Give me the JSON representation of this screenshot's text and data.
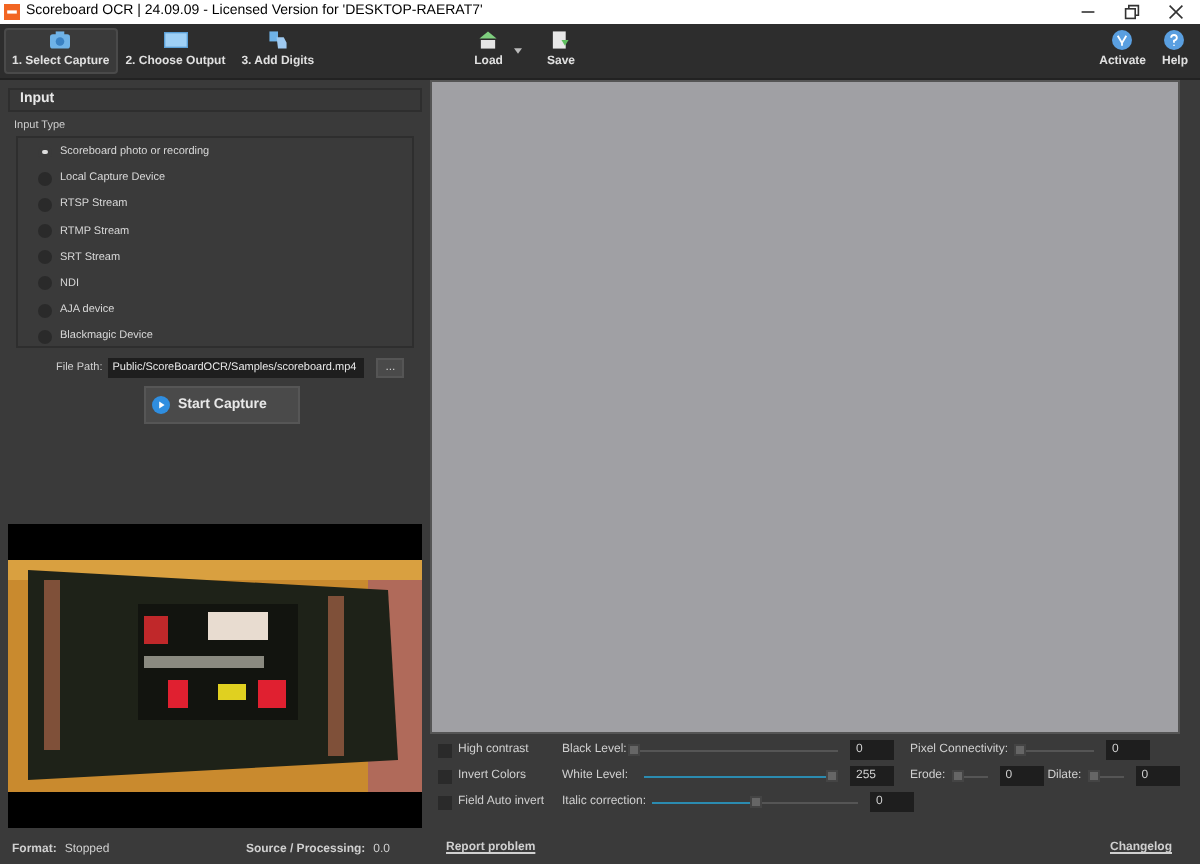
{
  "window": {
    "title": "Scoreboard OCR | 24.09.09 - Licensed Version for 'DESKTOP-RAERAT7'"
  },
  "toolbar": {
    "steps": [
      {
        "label": "1. Select Capture",
        "selected": true,
        "kind": "camera"
      },
      {
        "label": "2. Choose Output",
        "selected": false,
        "kind": "screen"
      },
      {
        "label": "3. Add Digits",
        "selected": false,
        "kind": "hand"
      }
    ],
    "actions": [
      {
        "label": "Load",
        "kind": "load"
      },
      {
        "label": "Save",
        "kind": "save"
      }
    ],
    "right": [
      {
        "label": "Activate",
        "kind": "activate"
      },
      {
        "label": "Help",
        "kind": "help"
      }
    ]
  },
  "input": {
    "header": "Input",
    "type_label": "Input Type",
    "options": [
      {
        "label": "Scoreboard photo or recording",
        "selected": true
      },
      {
        "label": "Local Capture Device",
        "selected": false
      },
      {
        "label": "RTSP Stream",
        "selected": false
      },
      {
        "label": "RTMP Stream",
        "selected": false
      },
      {
        "label": "SRT Stream",
        "selected": false
      },
      {
        "label": "NDI",
        "selected": false
      },
      {
        "label": "AJA device",
        "selected": false
      },
      {
        "label": "Blackmagic Device",
        "selected": false
      }
    ],
    "file_path_label": "File Path:",
    "file_path": "Public/ScoreBoardOCR/Samples/scoreboard.mp4",
    "browse": "...",
    "start": "Start Capture"
  },
  "status": {
    "format_label": "Format:",
    "format": "Stopped",
    "source_label": "Source / Processing:",
    "source": "0.0"
  },
  "controls": {
    "checks": [
      {
        "label": "High contrast",
        "checked": false
      },
      {
        "label": "Invert Colors",
        "checked": false
      },
      {
        "label": "Field Auto invert",
        "checked": false
      }
    ],
    "black": {
      "label": "Black Level:",
      "level": 0,
      "value": "0"
    },
    "white": {
      "label": "White Level:",
      "level": 1,
      "value": "255"
    },
    "italic": {
      "label": "Italic correction:",
      "level": 0.5,
      "value": "0"
    },
    "pixel": {
      "label": "Pixel Connectivity:",
      "level": 0,
      "value": "0"
    },
    "erode": {
      "label": "Erode:",
      "level": 0,
      "value": "0"
    },
    "dilate": {
      "label": "Dilate:",
      "level": 0,
      "value": "0"
    }
  },
  "links": {
    "report": "Report problem",
    "changelog": "Changelog"
  }
}
